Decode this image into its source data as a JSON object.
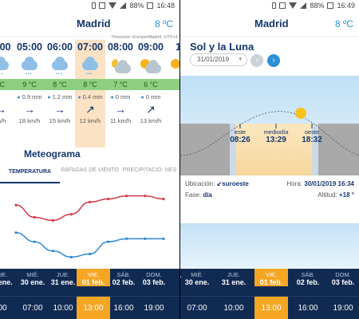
{
  "status": {
    "battery_left": "88%",
    "time_left": "16:48",
    "battery_right": "88%",
    "time_right": "16:49"
  },
  "header": {
    "city": "Madrid",
    "temp": "8 ºC"
  },
  "timezone": "Timezone: Europe/Madrid, UTC+1",
  "hourly": [
    {
      "time": "5:00",
      "temp": "°C",
      "precip": "",
      "wind": "m/h"
    },
    {
      "time": "05:00",
      "temp": "9 °C",
      "precip": "0.9 mm",
      "wind": "18 km/h"
    },
    {
      "time": "06:00",
      "temp": "8 °C",
      "precip": "1.2 mm",
      "wind": "15 km/h"
    },
    {
      "time": "07:00",
      "temp": "8 °C",
      "precip": "0.4 mm",
      "wind": "12 km/h"
    },
    {
      "time": "08:00",
      "temp": "7 °C",
      "precip": "0 mm",
      "wind": "11 km/h"
    },
    {
      "time": "09:00",
      "temp": "6 °C",
      "precip": "0 mm",
      "wind": "13 km/h"
    },
    {
      "time": "10",
      "temp": "",
      "precip": "",
      "wind": ""
    }
  ],
  "meteograma": {
    "title": "Meteograma",
    "tabs": [
      "TEMPERATURA",
      "RÁFAGAS DE VIENTO",
      "PRECIPITACIO- NES"
    ]
  },
  "days": [
    {
      "dow": "UE.",
      "date": "9 ene."
    },
    {
      "dow": "MIÉ.",
      "date": "30 ene."
    },
    {
      "dow": "JUE.",
      "date": "31 ene."
    },
    {
      "dow": "VIE.",
      "date": "01 feb."
    },
    {
      "dow": "SÁB.",
      "date": "02 feb."
    },
    {
      "dow": "DOM.",
      "date": "03 feb."
    },
    {
      "dow": "LU",
      "date": "04"
    }
  ],
  "day_times": [
    "00",
    "07:00",
    "10:00",
    "13:00",
    "16:00",
    "19:00",
    "22"
  ],
  "days_right": [
    {
      "dow": "",
      "date": "ne."
    },
    {
      "dow": "MIÉ.",
      "date": "30 ene."
    },
    {
      "dow": "JUE.",
      "date": "31 ene."
    },
    {
      "dow": "VIE.",
      "date": "01 feb."
    },
    {
      "dow": "SÁB.",
      "date": "02 feb."
    },
    {
      "dow": "DOM.",
      "date": "03 feb."
    }
  ],
  "day_times_right": [
    "",
    "07:00",
    "10:00",
    "13:00",
    "16:00",
    "19:00"
  ],
  "sun": {
    "title": "Sol y la Luna",
    "date": "31/01/2019",
    "sunrise_label": "este",
    "sunrise": "08:26",
    "noon_label": "mediodía",
    "noon": "13:29",
    "sunset_label": "oeste",
    "sunset": "18:32"
  },
  "info": {
    "location_label": "Ubicación:",
    "location_value": "↙suroeste",
    "hour_label": "Hora:",
    "hour_value": "30/01/2019 16:34",
    "phase_label": "Fase:",
    "phase_value": "día",
    "altitude_label": "Altitud:",
    "altitude_value": "+18 °"
  },
  "chart_data": {
    "type": "line",
    "series": [
      {
        "name": "",
        "values": [
          13,
          9,
          8,
          10,
          14,
          15,
          16,
          16,
          15
        ]
      },
      {
        "name": "",
        "values": [
          4,
          1,
          -2,
          -4,
          -3,
          1,
          2,
          2,
          2
        ]
      }
    ],
    "colors": [
      "#d6354a",
      "#2f86cf"
    ]
  }
}
